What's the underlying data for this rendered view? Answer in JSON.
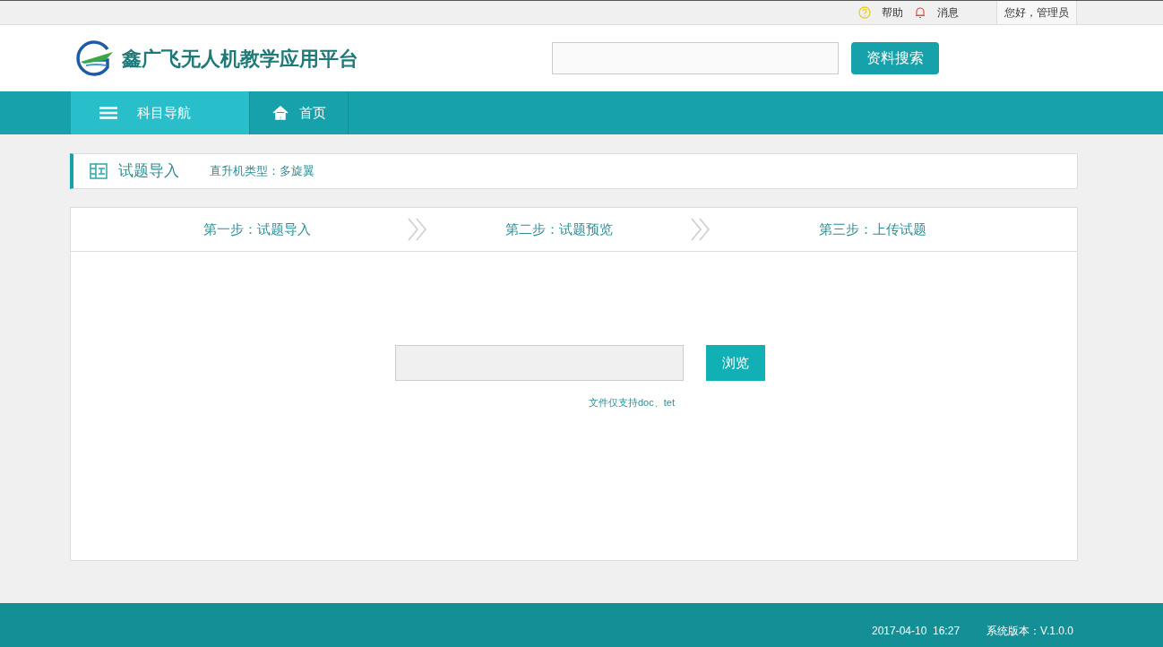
{
  "top_bar": {
    "help": "帮助",
    "messages": "消息",
    "greeting": "您好，管理员"
  },
  "header": {
    "title": "鑫广飞无人机教学应用平台",
    "search_button": "资料搜索"
  },
  "nav": [
    {
      "label": "科目导航",
      "kind": "menu",
      "selected": true
    },
    {
      "label": "首页",
      "kind": "home",
      "selected": false
    }
  ],
  "page_header": {
    "title": "试题导入",
    "subtitle": "直升机类型：多旋翼"
  },
  "steps": [
    "第一步：试题导入",
    "第二步：试题预览",
    "第三步：上传试题"
  ],
  "upload": {
    "button": "浏览",
    "hint": "文件仅支持doc、tet"
  },
  "footer": {
    "datetime": "2017-04-10  16:27",
    "version": "系统版本：V.1.0.0"
  }
}
